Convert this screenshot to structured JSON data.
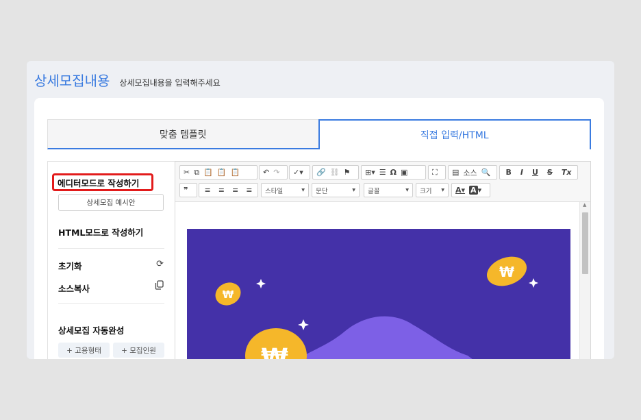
{
  "header": {
    "title": "상세모집내용",
    "subtitle": "상세모집내용을 입력해주세요"
  },
  "tabs": [
    {
      "label": "맞춤 템플릿",
      "active": false
    },
    {
      "label": "직접 입력/HTML",
      "active": true
    }
  ],
  "sidebar": {
    "editor_mode_label": "에디터모드로 작성하기",
    "sample_button_label": "상세모집 예시안",
    "html_mode_label": "HTML모드로 작성하기",
    "reset_label": "초기화",
    "copy_source_label": "소스복사",
    "autocomplete_title": "상세모집 자동완성",
    "tags": [
      "+ 고용형태",
      "+ 모집인원"
    ]
  },
  "toolbar": {
    "source_label": "소스",
    "bold": "B",
    "italic": "I",
    "underline": "U",
    "strike": "S",
    "clear_format": "Tx",
    "style_label": "스타일",
    "format_label": "문단",
    "font_label": "글꼴",
    "size_label": "크기",
    "text_color_label": "A",
    "bg_color_label": "A"
  },
  "colors": {
    "accent": "#3a7be0",
    "highlight_border": "#e21b1b",
    "banner_bg": "#4431a8",
    "coin": "#f5b72a"
  }
}
